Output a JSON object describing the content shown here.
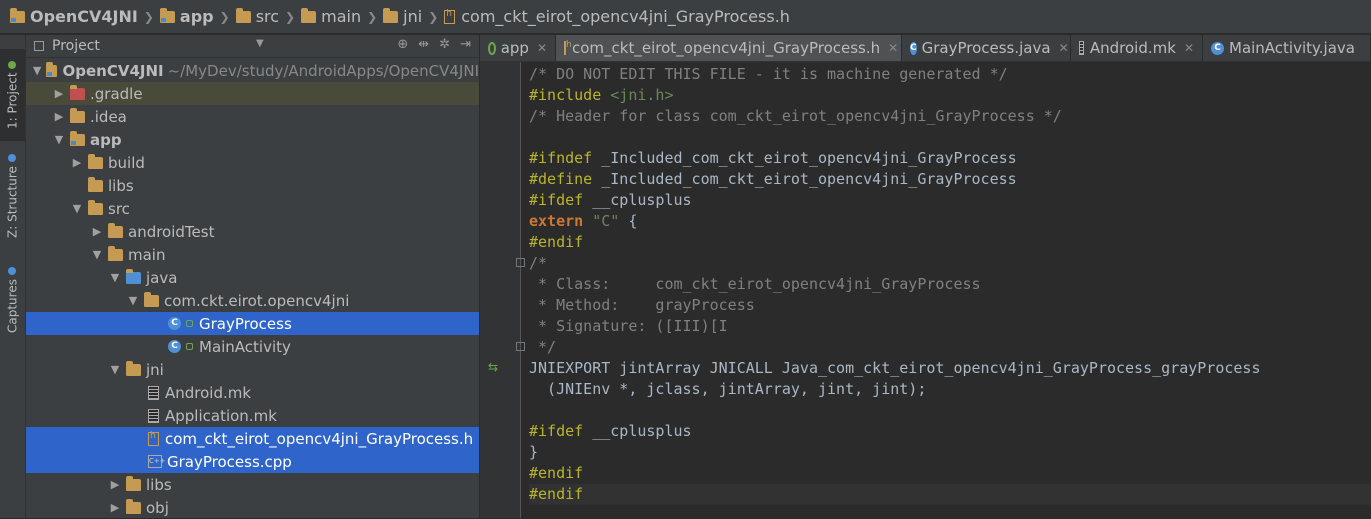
{
  "breadcrumbs": [
    "OpenCV4JNI",
    "app",
    "src",
    "main",
    "jni",
    "com_ckt_eirot_opencv4jni_GrayProcess.h"
  ],
  "toolstrip": {
    "project": "1: Project",
    "structure": "Z: Structure",
    "captures": "Captures"
  },
  "panel": {
    "title": "Project"
  },
  "tree": [
    {
      "label": "OpenCV4JNI",
      "path": "~/MyDev/study/AndroidApps/OpenCV4JNI"
    },
    {
      "label": ".gradle"
    },
    {
      "label": ".idea"
    },
    {
      "label": "app"
    },
    {
      "label": "build"
    },
    {
      "label": "libs"
    },
    {
      "label": "src"
    },
    {
      "label": "androidTest"
    },
    {
      "label": "main"
    },
    {
      "label": "java"
    },
    {
      "label": "com.ckt.eirot.opencv4jni"
    },
    {
      "label": "GrayProcess"
    },
    {
      "label": "MainActivity"
    },
    {
      "label": "jni"
    },
    {
      "label": "Android.mk"
    },
    {
      "label": "Application.mk"
    },
    {
      "label": "com_ckt_eirot_opencv4jni_GrayProcess.h"
    },
    {
      "label": "GrayProcess.cpp"
    },
    {
      "label": "libs"
    },
    {
      "label": "obj"
    }
  ],
  "tabs": [
    {
      "label": "app"
    },
    {
      "label": "com_ckt_eirot_opencv4jni_GrayProcess.h"
    },
    {
      "label": "GrayProcess.java"
    },
    {
      "label": "Android.mk"
    },
    {
      "label": "MainActivity.java"
    }
  ],
  "code": [
    {
      "segs": [
        [
          "cm",
          "/* DO NOT EDIT THIS FILE - it is machine generated */"
        ]
      ]
    },
    {
      "segs": [
        [
          "pp",
          "#include "
        ],
        [
          "st",
          "<jni.h>"
        ]
      ]
    },
    {
      "segs": [
        [
          "cm",
          "/* Header for class com_ckt_eirot_opencv4jni_GrayProcess */"
        ]
      ]
    },
    {
      "segs": [
        [
          "pl",
          ""
        ]
      ]
    },
    {
      "segs": [
        [
          "pp",
          "#ifndef "
        ],
        [
          "pl",
          "_Included_com_ckt_eirot_opencv4jni_GrayProcess"
        ]
      ]
    },
    {
      "segs": [
        [
          "pp",
          "#define "
        ],
        [
          "pl",
          "_Included_com_ckt_eirot_opencv4jni_GrayProcess"
        ]
      ]
    },
    {
      "segs": [
        [
          "pp",
          "#ifdef "
        ],
        [
          "pl",
          "__cplusplus"
        ]
      ]
    },
    {
      "segs": [
        [
          "kw",
          "extern "
        ],
        [
          "st",
          "\"C\""
        ],
        [
          "pl",
          " {"
        ]
      ]
    },
    {
      "segs": [
        [
          "pp",
          "#endif"
        ]
      ]
    },
    {
      "segs": [
        [
          "cm",
          "/*"
        ]
      ]
    },
    {
      "segs": [
        [
          "cm",
          " * Class:     com_ckt_eirot_opencv4jni_GrayProcess"
        ]
      ]
    },
    {
      "segs": [
        [
          "cm",
          " * Method:    grayProcess"
        ]
      ]
    },
    {
      "segs": [
        [
          "cm",
          " * Signature: ([III)[I"
        ]
      ]
    },
    {
      "segs": [
        [
          "cm",
          " */"
        ]
      ]
    },
    {
      "segs": [
        [
          "pl",
          "JNIEXPORT jintArray JNICALL Java_com_ckt_eirot_opencv4jni_GrayProcess_grayProcess"
        ]
      ]
    },
    {
      "segs": [
        [
          "pl",
          "  (JNIEnv *, jclass, jintArray, jint, jint);"
        ]
      ]
    },
    {
      "segs": [
        [
          "pl",
          ""
        ]
      ]
    },
    {
      "segs": [
        [
          "pp",
          "#ifdef "
        ],
        [
          "pl",
          "__cplusplus"
        ]
      ]
    },
    {
      "segs": [
        [
          "pl",
          "}"
        ]
      ]
    },
    {
      "segs": [
        [
          "pp",
          "#endif"
        ]
      ]
    },
    {
      "segs": [
        [
          "pp",
          "#endif"
        ]
      ]
    }
  ]
}
